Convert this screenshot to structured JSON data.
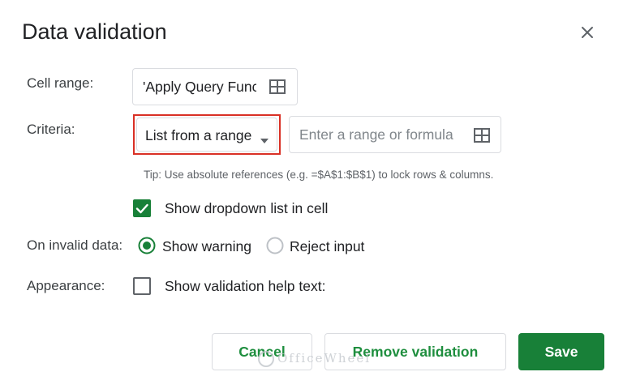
{
  "dialog": {
    "title": "Data validation",
    "close_icon": "close-icon"
  },
  "cell_range": {
    "label": "Cell range:",
    "value": "'Apply Query Func",
    "icon": "grid-icon"
  },
  "criteria": {
    "label": "Criteria:",
    "selected": "List from a range",
    "dropdown_icon": "caret-down-icon",
    "range_placeholder": "Enter a range or formula",
    "range_icon": "grid-icon",
    "highlight_color": "#d93025"
  },
  "tip": "Tip: Use absolute references (e.g. =$A$1:$B$1) to lock rows & columns.",
  "show_dropdown": {
    "label": "Show dropdown list in cell",
    "checked": true
  },
  "invalid_data": {
    "label": "On invalid data:",
    "options": [
      {
        "label": "Show warning",
        "selected": true
      },
      {
        "label": "Reject input",
        "selected": false
      }
    ]
  },
  "appearance": {
    "label": "Appearance:",
    "checkbox_label": "Show validation help text:",
    "checked": false
  },
  "buttons": {
    "cancel": "Cancel",
    "remove": "Remove validation",
    "save": "Save"
  },
  "watermark": "OfficeWheel",
  "colors": {
    "accent_green": "#188038",
    "text_green": "#1e8e3e"
  }
}
